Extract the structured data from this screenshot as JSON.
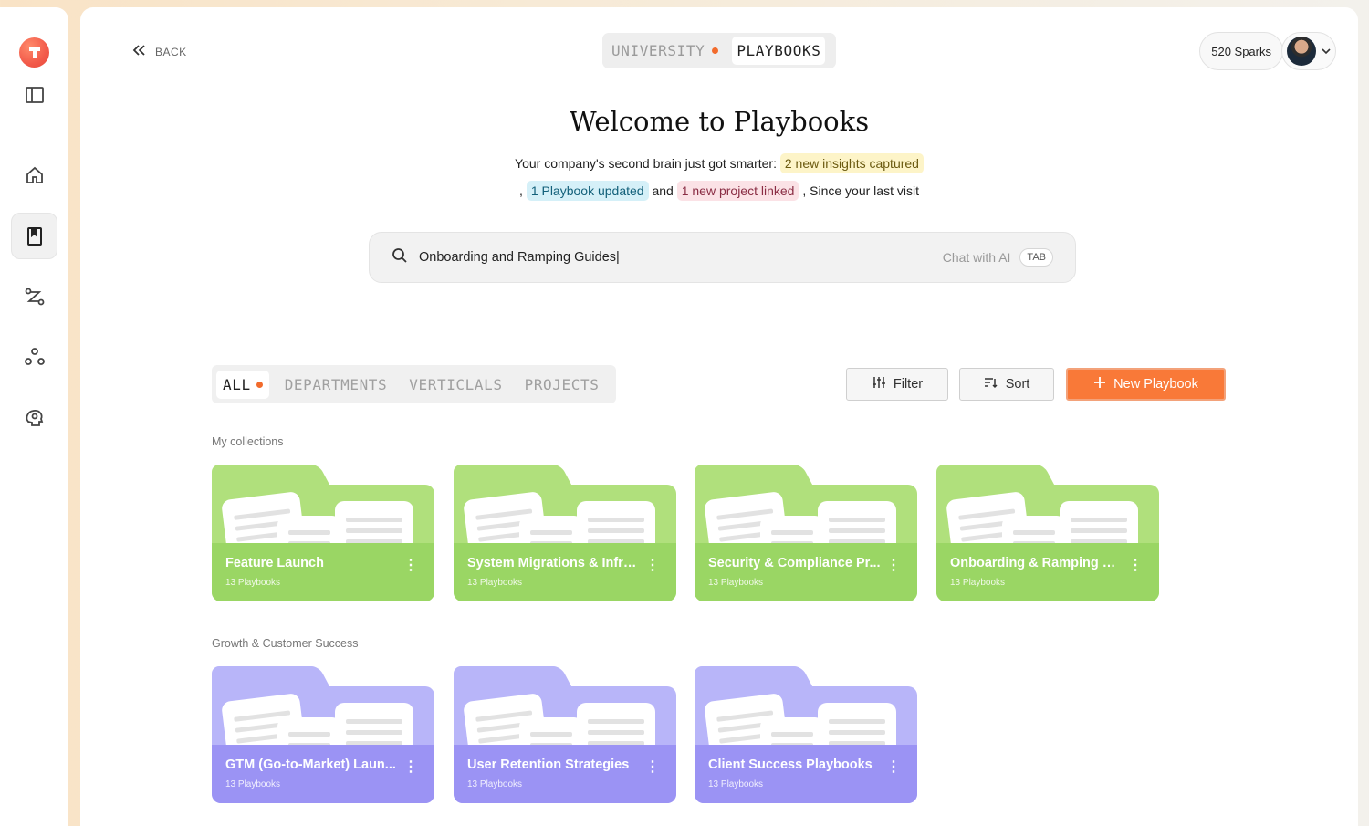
{
  "nav": {
    "icons": [
      "sidebar-panel-icon",
      "home-icon",
      "playbook-icon",
      "workflow-icon",
      "connections-icon",
      "brain-icon"
    ],
    "active": "playbook-icon"
  },
  "header": {
    "back_label": "BACK",
    "tabs": [
      {
        "label": "UNIVERSITY",
        "dot": true,
        "active": false
      },
      {
        "label": "PLAYBOOKS",
        "dot": false,
        "active": true
      }
    ],
    "sparks": "520 Sparks"
  },
  "hero": {
    "title": "Welcome to Playbooks",
    "line1_prefix": "Your company's second brain just got smarter:",
    "insights": "2 new insights captured",
    "line2_comma": ",",
    "updated": "1 Playbook updated",
    "and": "and",
    "linked": "1 new project linked",
    "suffix": ", Since your last visit"
  },
  "search": {
    "value": "Onboarding and Ramping Guides|",
    "chat_label": "Chat with AI",
    "tab_hint": "TAB"
  },
  "filters": {
    "tabs": [
      "ALL",
      "DEPARTMENTS",
      "VERTICLALS",
      "PROJECTS"
    ],
    "active": "ALL",
    "filter_label": "Filter",
    "sort_label": "Sort",
    "new_label": "New Playbook"
  },
  "colors": {
    "accent": "#f97938",
    "green_folder": "#9ad664",
    "violet_folder": "#9b93f4"
  },
  "sections": [
    {
      "title": "My collections",
      "items": [
        {
          "name": "Feature Launch",
          "count": "13 Playbooks"
        },
        {
          "name": "System Migrations & Infra...",
          "count": "13 Playbooks"
        },
        {
          "name": "Security & Compliance Pr...",
          "count": "13 Playbooks"
        },
        {
          "name": "Onboarding & Ramping Gu...",
          "count": "13 Playbooks"
        }
      ]
    },
    {
      "title": "Growth & Customer Success",
      "items": [
        {
          "name": "GTM (Go-to-Market) Laun...",
          "count": "13 Playbooks"
        },
        {
          "name": "User Retention Strategies",
          "count": "13 Playbooks"
        },
        {
          "name": "Client Success Playbooks",
          "count": "13 Playbooks"
        }
      ]
    }
  ]
}
